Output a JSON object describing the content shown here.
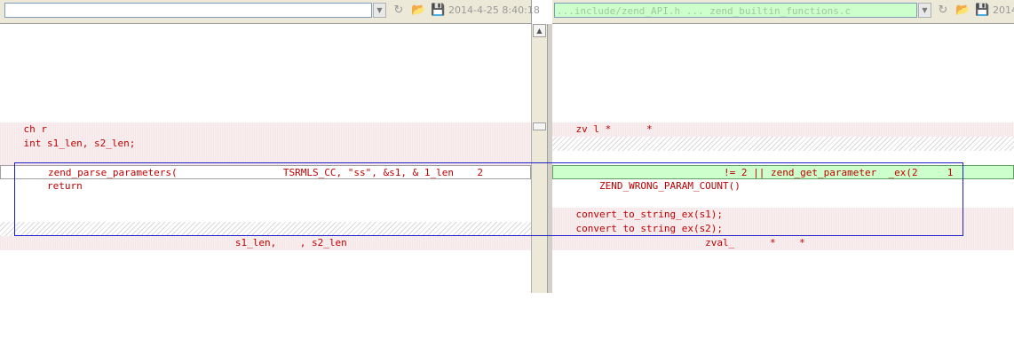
{
  "left": {
    "path_value": "",
    "timestamp": "2014-4-25 8:40:18",
    "lines": {
      "l1": "    ch r",
      "l2": "    int s1_len, s2_len;",
      "l3": "        zend_parse_parameters(                  TSRMLS_CC, \"ss\", &s1, & 1_len    2",
      "l4": "        return",
      "l5": "                                        s1_len,    , s2_len"
    }
  },
  "right": {
    "path_value": "...include/zend_API.h ... zend_builtin_functions.c",
    "timestamp": "2014",
    "lines": {
      "l1": "    zv l *      *",
      "l2": "                             != 2 || zend_get_parameter  _ex(2     1",
      "l3": "        ZEND_WRONG_PARAM_COUNT()",
      "l4": "    convert_to_string_ex(s1);",
      "l5": "    convert to string ex(s2);",
      "l6": "                          zval_      *    *"
    }
  },
  "icons": {
    "dropdown": "chevron-down-icon",
    "refresh": "refresh-icon",
    "open": "folder-open-icon",
    "save": "save-icon"
  },
  "colors": {
    "code_text": "#c00000",
    "changed_line": "#ccffcc",
    "removed_block": "#fbeef0",
    "selection_box": "#2020c8"
  }
}
